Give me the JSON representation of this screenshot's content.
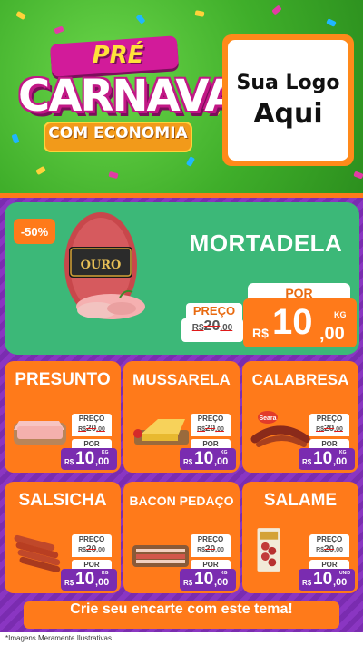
{
  "header": {
    "title_pre": "PRÉ",
    "title_main": "CARNAVAL",
    "title_sub": "COM ECONOMIA",
    "logo_line1": "Sua Logo",
    "logo_line2": "Aqui"
  },
  "featured": {
    "discount": "-50%",
    "name": "MORTADELA",
    "brand": "OURO",
    "preco_label": "PREÇO",
    "old_price_currency": "R$",
    "old_price_int": "20",
    "old_price_dec": ",00",
    "por_label": "POR",
    "currency": "R$",
    "price_int": "10",
    "price_dec": ",00",
    "unit": "KG"
  },
  "products": [
    {
      "name": "PRESUNTO",
      "preco_label": "PREÇO",
      "old_currency": "R$",
      "old_int": "20",
      "old_dec": ",00",
      "por_label": "POR",
      "currency": "R$",
      "price_int": "10",
      "price_dec": ",00",
      "unit": "KG"
    },
    {
      "name": "MUSSARELA",
      "preco_label": "PREÇO",
      "old_currency": "R$",
      "old_int": "20",
      "old_dec": ",00",
      "por_label": "POR",
      "currency": "R$",
      "price_int": "10",
      "price_dec": ",00",
      "unit": "KG"
    },
    {
      "name": "CALABRESA",
      "preco_label": "PREÇO",
      "old_currency": "R$",
      "old_int": "20",
      "old_dec": ",00",
      "por_label": "POR",
      "currency": "R$",
      "price_int": "10",
      "price_dec": ",00",
      "unit": "KG",
      "brand": "Seara"
    },
    {
      "name": "SALSICHA",
      "preco_label": "PREÇO",
      "old_currency": "R$",
      "old_int": "20",
      "old_dec": ",00",
      "por_label": "POR",
      "currency": "R$",
      "price_int": "10",
      "price_dec": ",00",
      "unit": "KG"
    },
    {
      "name": "BACON PEDAÇO",
      "preco_label": "PREÇO",
      "old_currency": "R$",
      "old_int": "20",
      "old_dec": ",00",
      "por_label": "POR",
      "currency": "R$",
      "price_int": "10",
      "price_dec": ",00",
      "unit": "KG"
    },
    {
      "name": "SALAME",
      "preco_label": "PREÇO",
      "old_currency": "R$",
      "old_int": "20",
      "old_dec": ",00",
      "por_label": "POR",
      "currency": "R$",
      "price_int": "10",
      "price_dec": ",00",
      "unit": "UNID"
    }
  ],
  "cta": "Crie seu encarte com este tema!",
  "disclaimer": "*Imagens Meramente Ilustrativas",
  "colors": {
    "header_green": "#3fae2a",
    "body_purple": "#7a2cb0",
    "featured_green": "#3cb878",
    "card_orange": "#ff7a1a",
    "price_purple": "#7a2cb0"
  }
}
